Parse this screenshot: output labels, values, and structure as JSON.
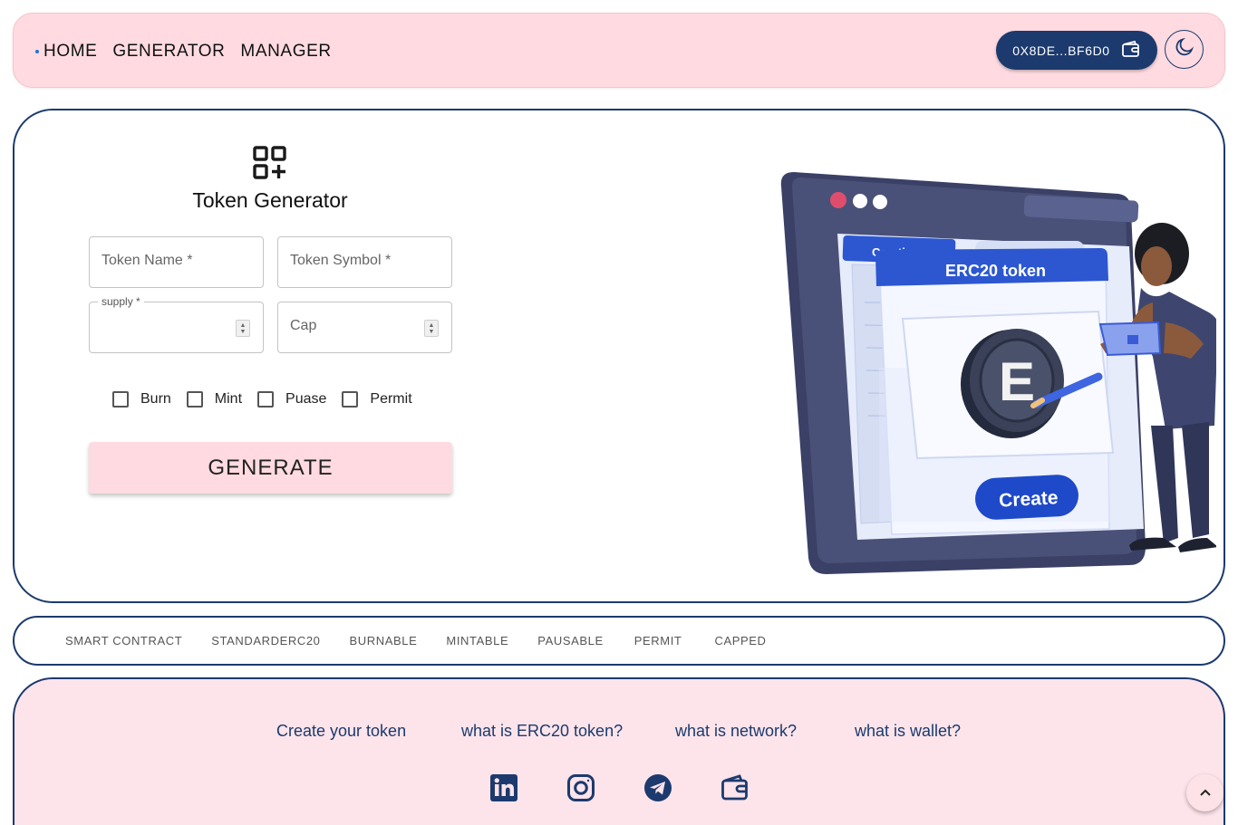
{
  "nav": {
    "links": [
      "HOME",
      "GENERATOR",
      "MANAGER"
    ],
    "wallet_address": "0X8DE...BF6D0",
    "icons": {
      "wallet": "wallet-icon",
      "theme": "moon-icon"
    }
  },
  "generator": {
    "title": "Token Generator",
    "icon": "grid-plus-icon",
    "fields": {
      "name_placeholder": "Token Name *",
      "symbol_placeholder": "Token Symbol *",
      "supply_label": "supply *",
      "supply_value": "",
      "cap_placeholder": "Cap"
    },
    "options": [
      {
        "label": "Burn",
        "checked": false
      },
      {
        "label": "Mint",
        "checked": false
      },
      {
        "label": "Puase",
        "checked": false
      },
      {
        "label": "Permit",
        "checked": false
      }
    ],
    "button_label": "GENERATE"
  },
  "illustration": {
    "tab_label": "Ceratice",
    "header_label": "ERC20 token",
    "coin_letter": "E",
    "button_label": "Create"
  },
  "tags": [
    "SMART CONTRACT",
    "STANDARDERC20",
    "BURNABLE",
    "MINTABLE",
    "PAUSABLE",
    "PERMIT",
    "CAPPED"
  ],
  "footer": {
    "links": [
      "Create your token",
      "what is ERC20 token?",
      "what is network?",
      "what is wallet?"
    ],
    "social_icons": [
      "linkedin-icon",
      "instagram-icon",
      "telegram-icon",
      "wallet-icon"
    ]
  },
  "colors": {
    "primary": "#1c3a6e",
    "pink": "#ffdbe1",
    "footer_bg": "#fce4ea"
  }
}
